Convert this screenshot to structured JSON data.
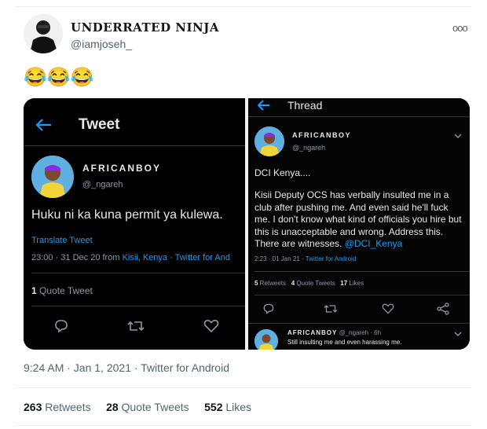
{
  "tweet": {
    "author_name": "UNDERRATED NINJA",
    "author_handle": "@iamjoseh_",
    "more_icon": "ooo",
    "emoji": "😂😂😂",
    "timestamp": "9:24 AM · Jan 1, 2021 · Twitter for Android",
    "stats": [
      {
        "count": "263",
        "label": "Retweets"
      },
      {
        "count": "28",
        "label": "Quote Tweets"
      },
      {
        "count": "552",
        "label": "Likes"
      }
    ]
  },
  "left_screenshot": {
    "header": "Tweet",
    "author": "AFRICANBOY",
    "handle": "@_ngareh",
    "text": "Huku ni ka kuna permit ya kulewa.",
    "translate": "Translate Tweet",
    "meta_time": "23:00 · 31 Dec 20 from ",
    "meta_place": "Kisii, Kenya",
    "meta_sep": " · ",
    "meta_source": "Twitter for And",
    "quote_count": "1",
    "quote_label": " Quote Tweet"
  },
  "right_screenshot": {
    "header": "Thread",
    "author": "AFRICANBOY",
    "handle": "@_ngareh",
    "line1": "DCI Kenya....",
    "body": "Kisii Deputy OCS has verbally insulted me in a club after pushing me. And even said he'll fuck me. I don't know what kind of officials you hire but this is unacceptable and wrong. Address this. There are witnesses. ",
    "mention": "@DCI_Kenya",
    "meta_time": "2:23 · 01 Jan 21 · ",
    "meta_source": "Twitter for Android",
    "stats": [
      {
        "count": "5",
        "label": " Retweets"
      },
      {
        "count": "4",
        "label": " Quote Tweets"
      },
      {
        "count": "17",
        "label": " Likes"
      }
    ],
    "reply_author": "AFRICANBOY",
    "reply_meta": " @_ngareh · 6h",
    "reply_text": "Still insulting me and even harassing me."
  },
  "icons": [
    "arrow-left-icon",
    "reply-icon",
    "retweet-icon",
    "like-icon",
    "share-icon",
    "chevron-down-icon"
  ]
}
